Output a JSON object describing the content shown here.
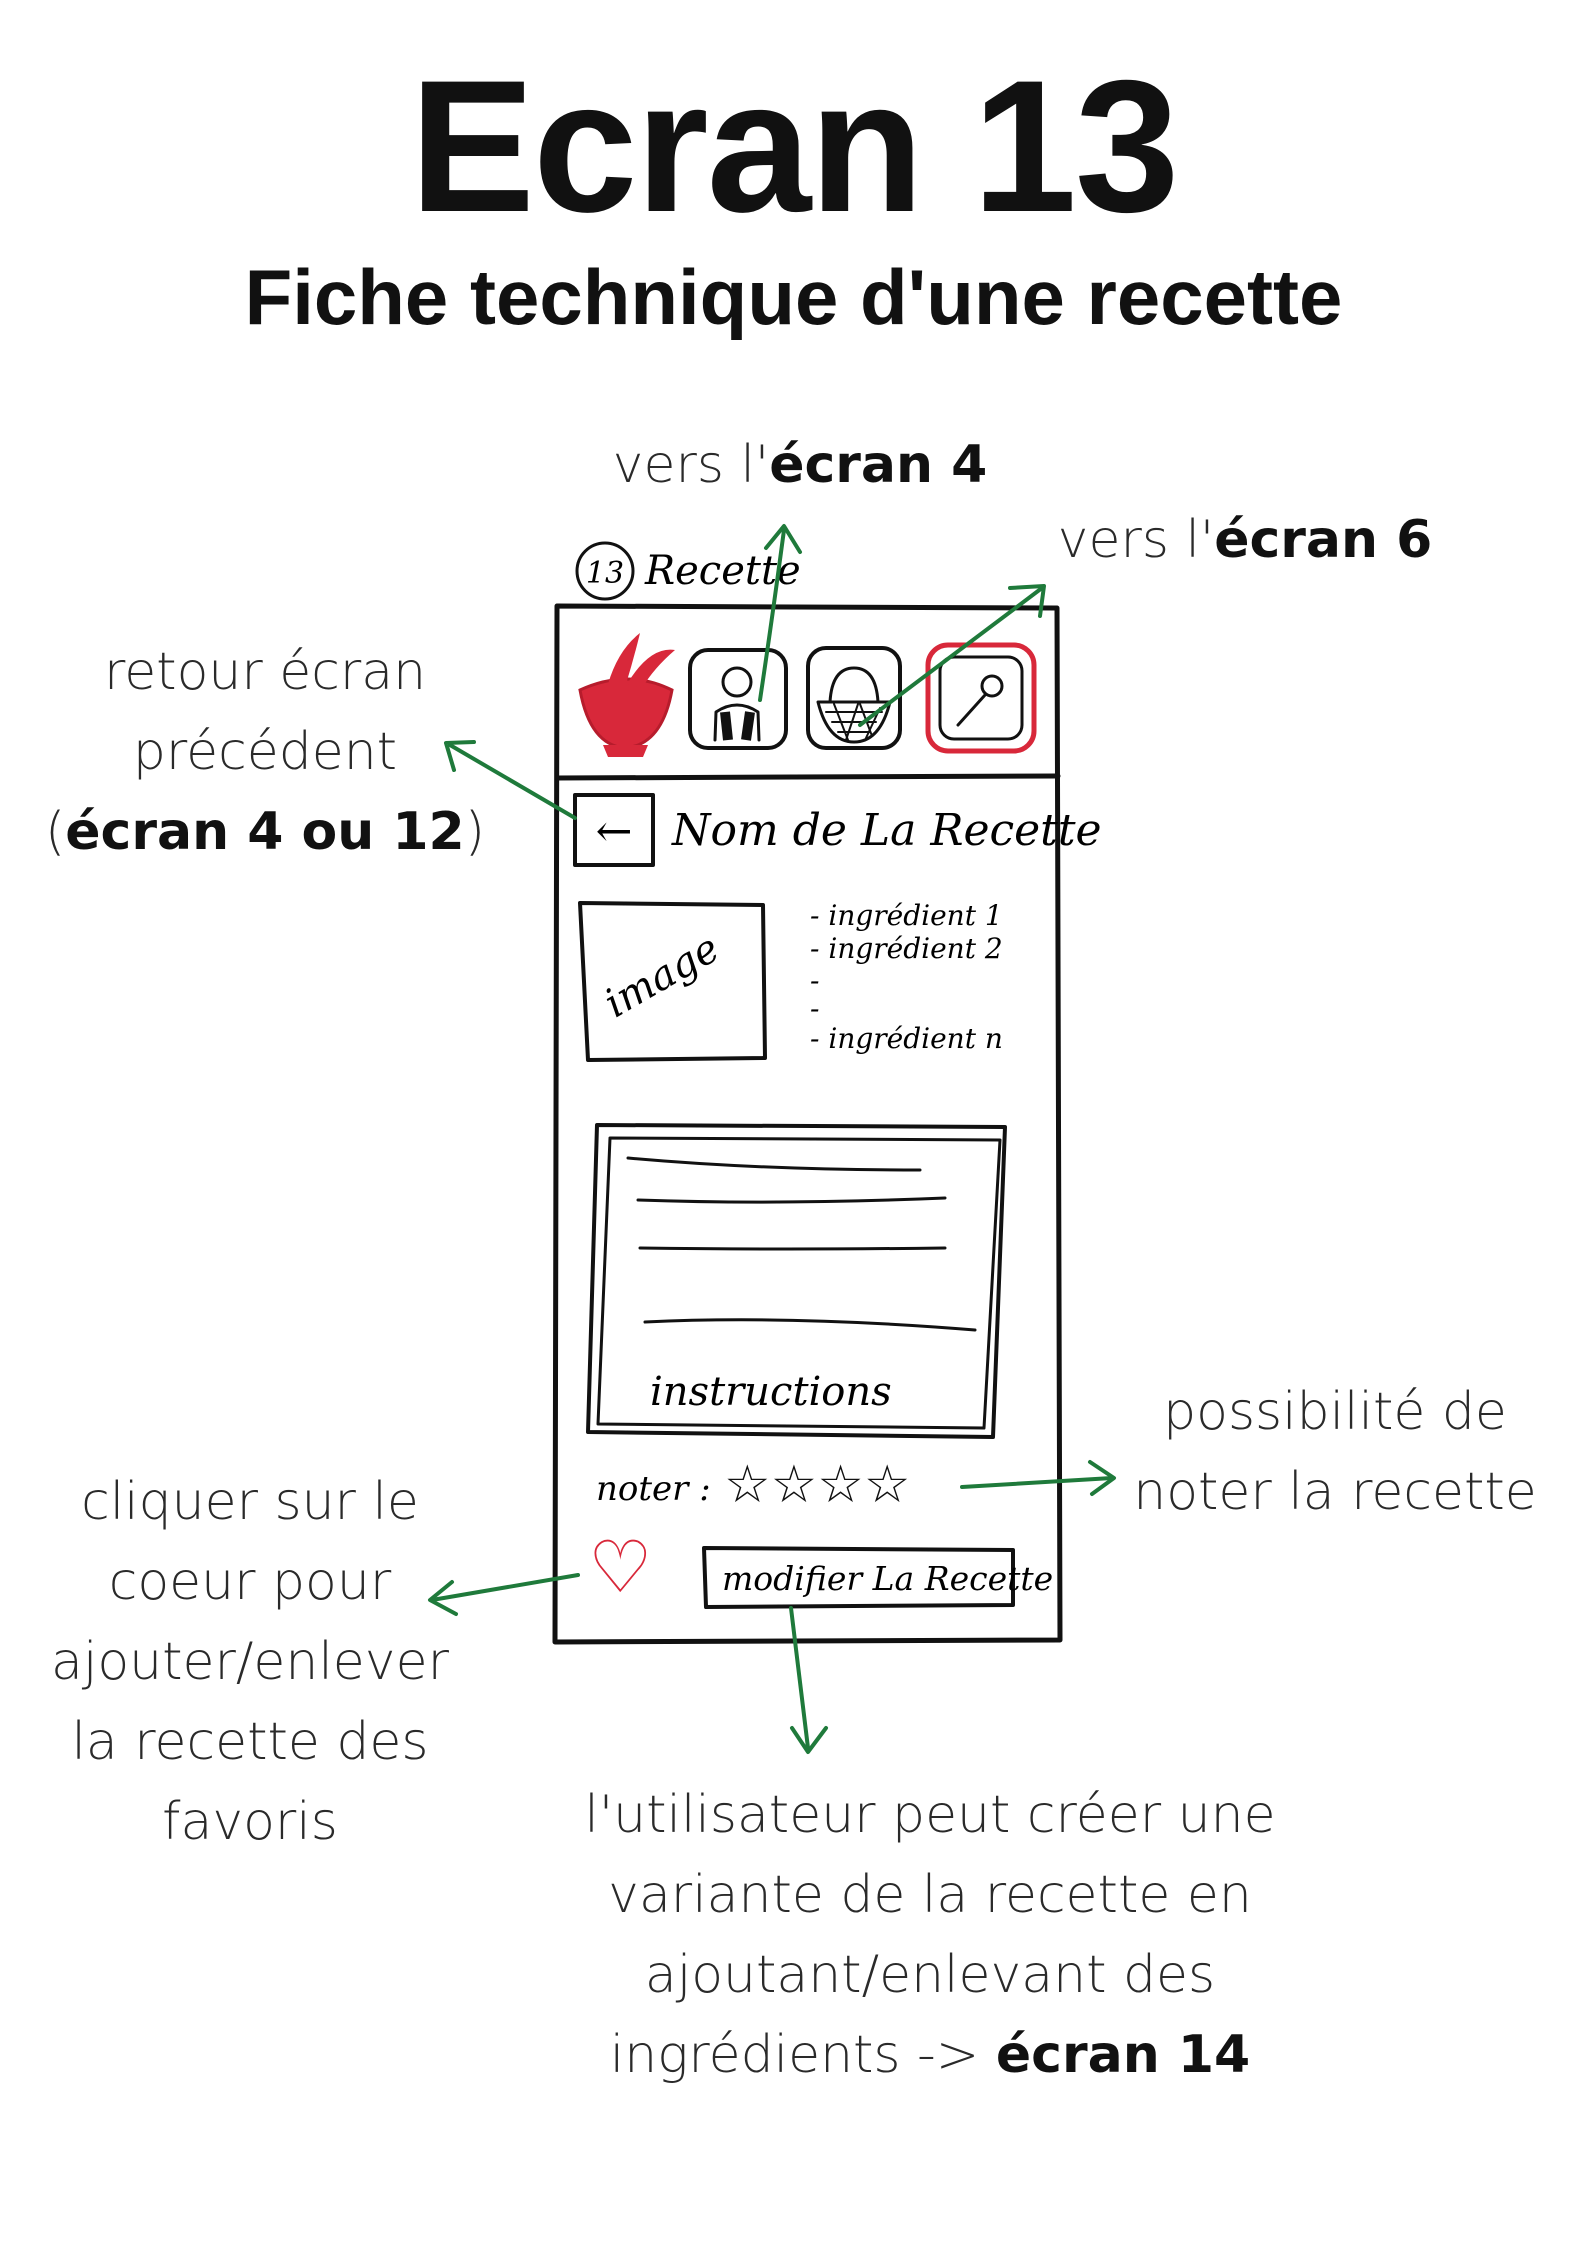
{
  "header": {
    "title": "Ecran 13",
    "subtitle": "Fiche technique d'une recette"
  },
  "annotations": {
    "to_screen4": {
      "prefix": "vers l'",
      "strong": "écran 4"
    },
    "to_screen6": {
      "prefix": "vers l'",
      "strong": "écran 6"
    },
    "back": {
      "line1": "retour  écran",
      "line2": "précédent",
      "open": "(",
      "strong": "écran 4 ou 12",
      "close": ")"
    },
    "rating": {
      "line1": "possibilité de",
      "line2": "noter la recette"
    },
    "heart": {
      "line1": "cliquer sur le",
      "line2": "coeur pour",
      "line3": "ajouter/enlever",
      "line4": "la recette des",
      "line5": "favoris"
    },
    "variant": {
      "line1": "l'utilisateur peut créer une",
      "line2": "variante de la recette en",
      "line3": "ajoutant/enlevant des",
      "line4_prefix": "ingrédients -> ",
      "line4_strong": "écran 14"
    }
  },
  "sketch": {
    "screen_number": "13",
    "screen_label": "Recette",
    "recipe_name": "Nom de La Recette",
    "image_label": "image",
    "ingredients": [
      "- ingrédient 1",
      "- ingrédient 2",
      "-",
      "-",
      "- ingrédient n"
    ],
    "instructions_label": "instructions",
    "rate_label": "noter :",
    "stars": "☆☆☆☆",
    "modify_button": "modifier La Recette",
    "back_glyph": "←",
    "heart_glyph": "♡"
  },
  "colors": {
    "accent_red": "#d8283a",
    "arrow_green": "#1f7a3b"
  }
}
